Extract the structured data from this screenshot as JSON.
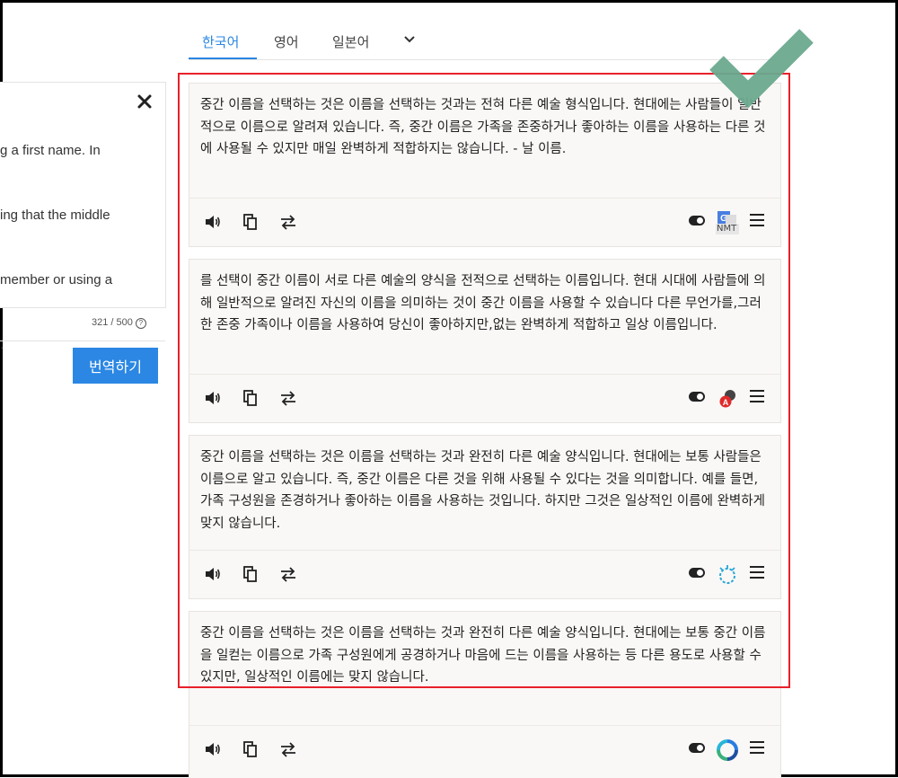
{
  "source": {
    "lines": [
      "g a first name. In",
      "ing that the middle",
      "member or using a",
      "."
    ],
    "char_count": "321 / 500",
    "help_glyph": "?",
    "translate_label": "번역하기",
    "close_glyph": "✕"
  },
  "tabs": [
    {
      "label": "한국어",
      "active": true
    },
    {
      "label": "영어",
      "active": false
    },
    {
      "label": "일본어",
      "active": false
    }
  ],
  "results": [
    {
      "text": "중간 이름을 선택하는 것은 이름을 선택하는 것과는 전혀 다른 예술 형식입니다. 현대에는 사람들이 일반적으로 이름으로 알려져 있습니다. 즉, 중간 이름은 가족을 존중하거나 좋아하는 이름을 사용하는 다른 것에 사용될 수 있지만 매일 완벽하게 적합하지는 않습니다. - 날 이름.",
      "engine": "google-nmt-icon",
      "engine_label": "NMT"
    },
    {
      "text": "를 선택이 중간 이름이 서로 다른 예술의 양식을 전적으로 선택하는 이름입니다. 현대 시대에 사람들에 의해 일반적으로 알려진 자신의 이름을 의미하는 것이 중간 이름을 사용할 수 있습니다 다른 무언가를,그러한 존중 가족이나 이름을 사용하여 당신이 좋아하지만,없는 완벽하게 적합하고 일상 이름입니다.",
      "engine": "ai-translate-icon",
      "engine_label": ""
    },
    {
      "text": "중간 이름을 선택하는 것은 이름을 선택하는 것과 완전히 다른 예술 양식입니다. 현대에는 보통 사람들은 이름으로 알고 있습니다. 즉, 중간 이름은 다른 것을 위해 사용될 수 있다는 것을 의미합니다. 예를 들면, 가족 구성원을 존경하거나 좋아하는 이름을 사용하는 것입니다. 하지만 그것은 일상적인 이름에 완벽하게 맞지 않습니다.",
      "engine": "watson-icon",
      "engine_label": ""
    },
    {
      "text": "중간 이름을 선택하는 것은 이름을 선택하는 것과 완전히 다른 예술 양식입니다. 현대에는 보통 중간 이름을 일컫는 이름으로 가족 구성원에게 공경하거나 마음에 드는 이름을 사용하는 등 다른 용도로 사용할 수 있지만, 일상적인 이름에는 맞지 않습니다.",
      "engine": "ring-engine-icon",
      "engine_label": ""
    }
  ],
  "colors": {
    "accent": "#2b87e3",
    "highlight": "#e8202a",
    "check": "#6aa98e",
    "card_bg": "#faf8f6"
  }
}
